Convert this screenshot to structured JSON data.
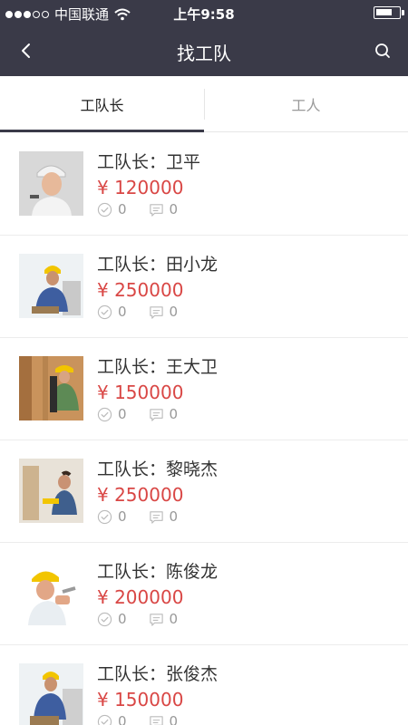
{
  "status_bar": {
    "carrier": "中国联通",
    "time": "上午9:58",
    "battery_level": 0.75
  },
  "navbar": {
    "title": "找工队",
    "back_icon": "chevron-left-icon",
    "search_icon": "search-icon"
  },
  "tabs": [
    {
      "label": "工队长",
      "active": true
    },
    {
      "label": "工人",
      "active": false
    }
  ],
  "items": [
    {
      "role": "工队长：",
      "name": "卫平",
      "price": "¥ 120000",
      "done_count": "0",
      "comment_count": "0"
    },
    {
      "role": "工队长：",
      "name": "田小龙",
      "price": "¥ 250000",
      "done_count": "0",
      "comment_count": "0"
    },
    {
      "role": "工队长：",
      "name": "王大卫",
      "price": "¥ 150000",
      "done_count": "0",
      "comment_count": "0"
    },
    {
      "role": "工队长：",
      "name": "黎晓杰",
      "price": "¥ 250000",
      "done_count": "0",
      "comment_count": "0"
    },
    {
      "role": "工队长：",
      "name": "陈俊龙",
      "price": "¥ 200000",
      "done_count": "0",
      "comment_count": "0"
    },
    {
      "role": "工队长：",
      "name": "张俊杰",
      "price": "¥ 150000",
      "done_count": "0",
      "comment_count": "0"
    }
  ],
  "colors": {
    "nav_bg": "#3a3a48",
    "price": "#d94745",
    "muted": "#999999"
  }
}
